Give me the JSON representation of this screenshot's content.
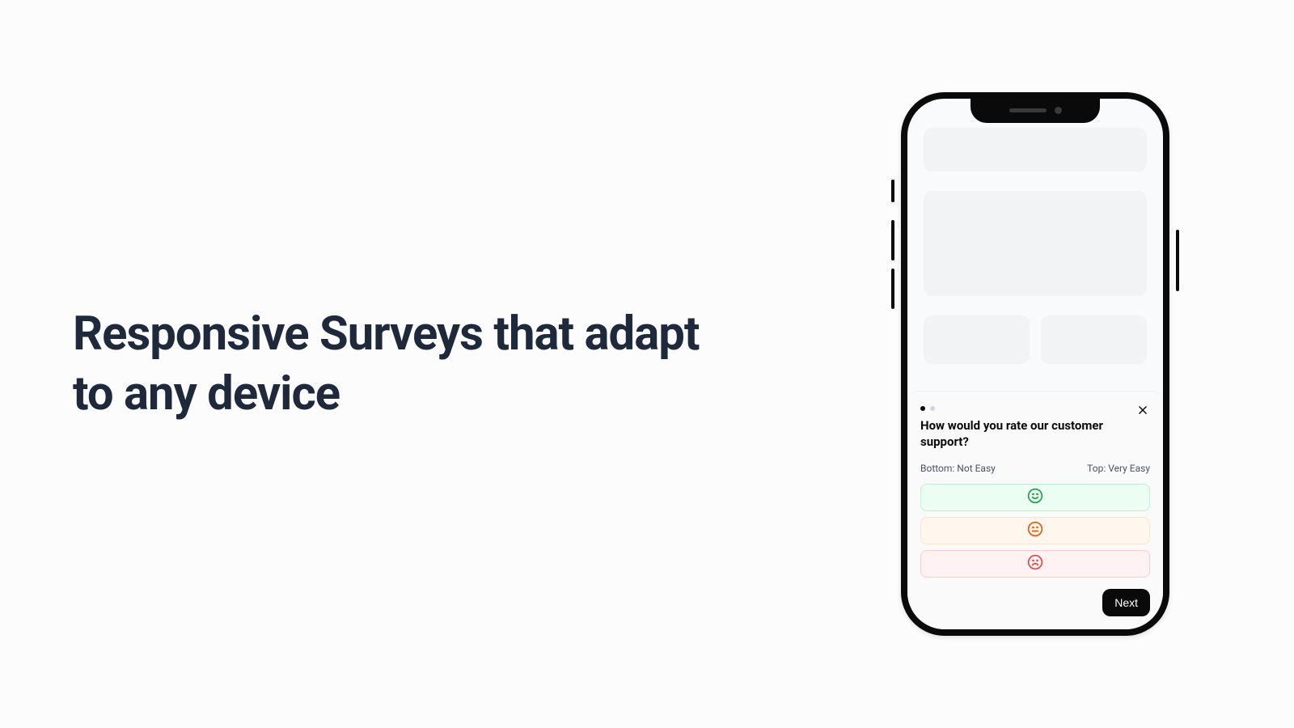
{
  "headline": "Responsive Surveys that adapt to any device",
  "survey": {
    "question": "How would you rate our customer support?",
    "bottom_label": "Bottom: Not Easy",
    "top_label": "Top: Very Easy",
    "next_label": "Next",
    "options": [
      {
        "name": "happy",
        "color": "#16a34a"
      },
      {
        "name": "neutral",
        "color": "#ea580c"
      },
      {
        "name": "sad",
        "color": "#ef4444"
      }
    ],
    "progress": {
      "current": 1,
      "total": 2
    }
  }
}
